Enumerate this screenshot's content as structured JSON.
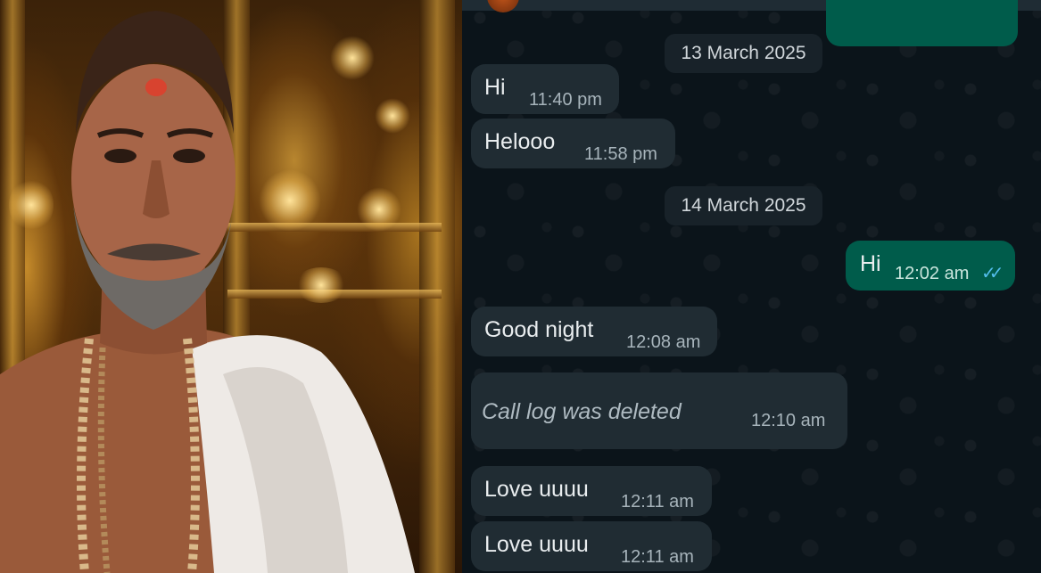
{
  "photo": {
    "description_icon": "person-photo"
  },
  "chat": {
    "messages": [
      {
        "type": "date",
        "text": "13 March 2025"
      },
      {
        "type": "in",
        "text": "Hi",
        "time": "11:40 pm"
      },
      {
        "type": "in",
        "text": "Helooo",
        "time": "11:58 pm"
      },
      {
        "type": "date",
        "text": "14 March 2025"
      },
      {
        "type": "out",
        "text": "Hi",
        "time": "12:02 am",
        "status_icon": "double-check-read-icon"
      },
      {
        "type": "in",
        "text": "Good night",
        "time": "12:08 am"
      },
      {
        "type": "in-deleted",
        "text": "Call log was deleted",
        "time": "12:10 am"
      },
      {
        "type": "in",
        "text": "Love uuuu",
        "time": "12:11 am"
      },
      {
        "type": "in",
        "text": "Love uuuu",
        "time": "12:11 am"
      }
    ]
  },
  "colors": {
    "chat_bg": "#0b141a",
    "incoming_bubble": "#202c33",
    "outgoing_bubble": "#005c4b",
    "read_tick": "#53bdeb"
  }
}
